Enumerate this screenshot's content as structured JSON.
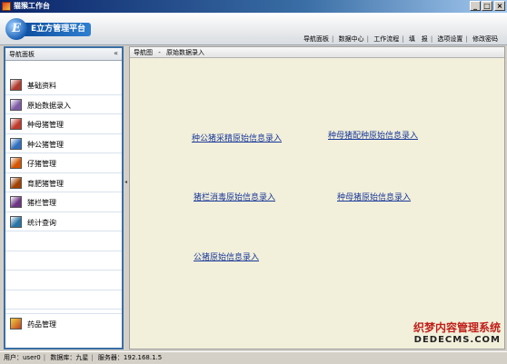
{
  "window": {
    "title": "猫猴工作台",
    "minimize": "_",
    "maximize": "□",
    "close": "×"
  },
  "header": {
    "logo_letter": "E",
    "logo_text": "E立方管理平台",
    "nav": [
      "导航面板",
      "数据中心",
      "工作流程",
      "填　报",
      "选项设置",
      "修改密码"
    ]
  },
  "sidebar": {
    "title": "导航面板",
    "collapse": "«",
    "items": [
      {
        "label": "基础资料",
        "color": "#b03a2e"
      },
      {
        "label": "原始数据录入",
        "color": "#7d5ba6"
      },
      {
        "label": "种母猪管理",
        "color": "#c0392b"
      },
      {
        "label": "种公猪管理",
        "color": "#2e6fbf"
      },
      {
        "label": "仔猪管理",
        "color": "#d35400"
      },
      {
        "label": "育肥猪管理",
        "color": "#a04000"
      },
      {
        "label": "猪栏管理",
        "color": "#6c3483"
      },
      {
        "label": "统计查询",
        "color": "#2874a6"
      }
    ],
    "bottom_item": "药品管理"
  },
  "breadcrumb": {
    "root": "导航图",
    "separator": "-",
    "current": "原始数据录入"
  },
  "links": {
    "boar_semen": "种公猪采精原始信息录入",
    "sow_breeding": "种母猪配种原始信息录入",
    "pen_disinfect": "猪栏消毒原始信息录入",
    "sow_info": "种母猪原始信息录入",
    "boar_info": "公猪原始信息录入"
  },
  "watermark": {
    "line1": "织梦内容管理系统",
    "line2": "DEDECMS.COM"
  },
  "statusbar": {
    "user": "用户：user0",
    "db": "数据库：九星",
    "server": "服务器：192.168.1.5"
  }
}
